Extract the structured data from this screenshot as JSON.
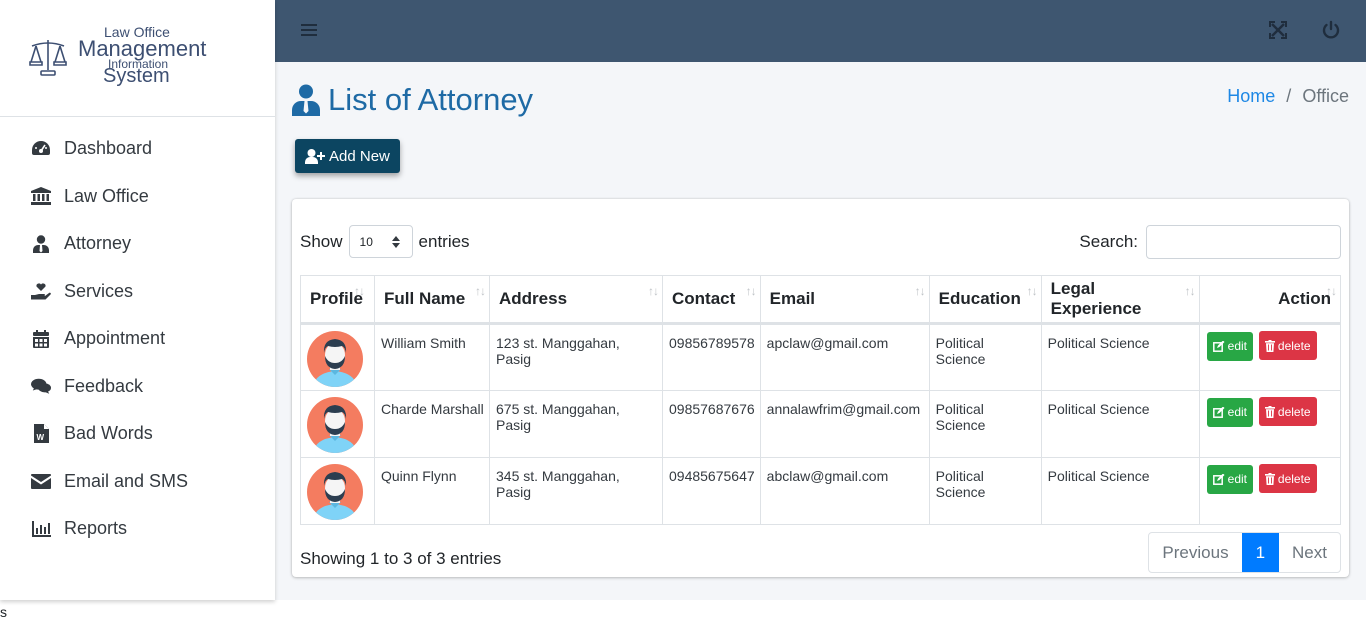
{
  "brand": {
    "line1": "Law Office",
    "line2": "Management",
    "line3": "Information",
    "line4": "System",
    "icon": "scales-of-justice-icon"
  },
  "sidebar": {
    "items": [
      {
        "label": "Dashboard",
        "icon": "tachometer-icon"
      },
      {
        "label": "Law Office",
        "icon": "university-icon"
      },
      {
        "label": "Attorney",
        "icon": "user-tie-icon"
      },
      {
        "label": "Services",
        "icon": "hand-holding-heart-icon"
      },
      {
        "label": "Appointment",
        "icon": "calendar-icon"
      },
      {
        "label": "Feedback",
        "icon": "comments-icon"
      },
      {
        "label": "Bad Words",
        "icon": "file-word-icon"
      },
      {
        "label": "Email and SMS",
        "icon": "envelope-icon"
      },
      {
        "label": "Reports",
        "icon": "chart-bar-icon"
      }
    ]
  },
  "topbar": {
    "menu_icon": "bars-icon",
    "expand_icon": "expand-arrows-icon",
    "power_icon": "power-off-icon"
  },
  "page": {
    "title": "List of Attorney",
    "breadcrumb": {
      "home": "Home",
      "separator": "/",
      "current": "Office"
    },
    "add_button": "Add New"
  },
  "table_controls": {
    "show_label": "Show",
    "entries_label": "entries",
    "page_length": "10",
    "search_label": "Search:",
    "search_value": ""
  },
  "table": {
    "columns": [
      "Profile",
      "Full Name",
      "Address",
      "Contact",
      "Email",
      "Education",
      "Legal Experience",
      "Action"
    ],
    "rows": [
      {
        "name": "William Smith",
        "address": "123 st. Manggahan, Pasig",
        "contact": "09856789578",
        "email": "apclaw@gmail.com",
        "education": "Political Science",
        "experience": "Political Science"
      },
      {
        "name": "Charde Marshall",
        "address": "675 st. Manggahan, Pasig",
        "contact": "09857687676",
        "email": "annalawfrim@gmail.com",
        "education": "Political Science",
        "experience": "Political Science"
      },
      {
        "name": "Quinn Flynn",
        "address": "345 st. Manggahan, Pasig",
        "contact": "09485675647",
        "email": "abclaw@gmail.com",
        "education": "Political Science",
        "experience": "Political Science"
      }
    ],
    "edit_label": "edit",
    "delete_label": "delete"
  },
  "footer": {
    "info": "Showing 1 to 3 of 3 entries",
    "previous": "Previous",
    "current_page": "1",
    "next": "Next",
    "stray_text": "s"
  },
  "colors": {
    "topbar": "#3e5670",
    "title": "#1e6aa5",
    "add_button": "#0c4561",
    "edit": "#28a745",
    "delete": "#dc3545",
    "page_active": "#007bff"
  }
}
